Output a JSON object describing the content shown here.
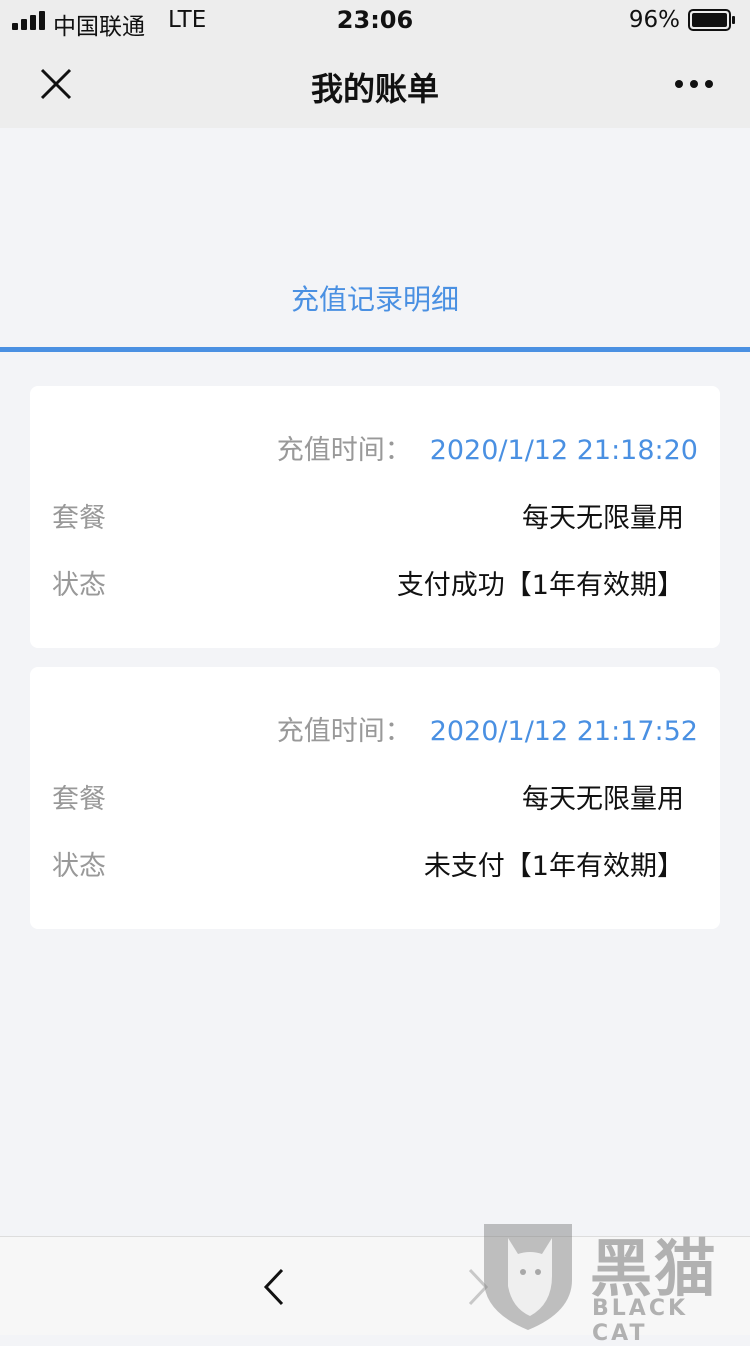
{
  "status_bar": {
    "carrier": "中国联通",
    "network": "LTE",
    "time": "23:06",
    "battery": "96%"
  },
  "nav": {
    "title": "我的账单"
  },
  "tab": {
    "label": "充值记录明细"
  },
  "records": [
    {
      "time_label": "充值时间：",
      "time": "2020/1/12 21:18:20",
      "plan_label": "套餐",
      "plan": "每天无限量用",
      "status_label": "状态",
      "status": "支付成功【1年有效期】"
    },
    {
      "time_label": "充值时间：",
      "time": "2020/1/12 21:17:52",
      "plan_label": "套餐",
      "plan": "每天无限量用",
      "status_label": "状态",
      "status": "未支付【1年有效期】"
    }
  ],
  "watermark": {
    "cn": "黑猫",
    "en": "BLACK CAT"
  },
  "colors": {
    "accent": "#4a90e2",
    "muted": "#999999",
    "background": "#f3f4f7"
  }
}
